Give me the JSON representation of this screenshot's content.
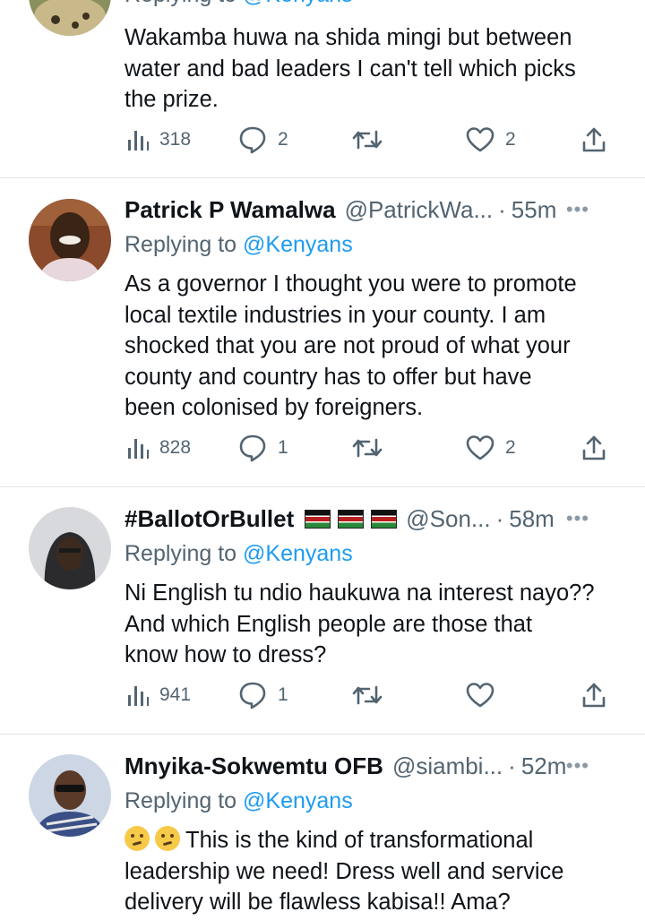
{
  "top_reply": {
    "replying_prefix": "Replying to",
    "replying_handle": "@Kenyans",
    "text_lines": [
      "Wakamba huwa na shida mingi but between",
      "water and bad leaders I can't tell which picks",
      "the prize."
    ],
    "views": "318",
    "replies": "2",
    "retweets": "",
    "likes": "2"
  },
  "tweets": [
    {
      "name": "Patrick P Wamalwa",
      "handle": "@PatrickWa...",
      "dot": "·",
      "time": "55m",
      "more": "•••",
      "replying_prefix": "Replying to",
      "replying_handle": "@Kenyans",
      "text_lines": [
        "As a governor I thought you were to promote",
        "local textile industries in your county. I am",
        "shocked that you are not proud of what your",
        "county and country has to offer but have",
        "been colonised by foreigners."
      ],
      "views": "828",
      "replies": "1",
      "retweets": "",
      "likes": "2"
    },
    {
      "name": "#BallotOrBullet",
      "handle": "@Son...",
      "dot": "·",
      "time": "58m",
      "more": "•••",
      "replying_prefix": "Replying to",
      "replying_handle": "@Kenyans",
      "text_lines": [
        "Ni English tu ndio haukuwa na interest nayo??",
        "And which English people are those that",
        "know how to dress?"
      ],
      "views": "941",
      "replies": "1",
      "retweets": "",
      "likes": ""
    },
    {
      "name": "Mnyika-Sokwemtu OFB",
      "handle": "@siambi...",
      "dot": "·",
      "time": "52m",
      "more": "•••",
      "replying_prefix": "Replying to",
      "replying_handle": "@Kenyans",
      "text_lines": [
        "This is the kind of transformational",
        "leadership we need! Dress well and service",
        "delivery will be flawless kabisa!! Ama?"
      ]
    }
  ],
  "icons": {
    "views": "analytics-icon",
    "reply": "reply-bubble-icon",
    "retweet": "retweet-icon",
    "like": "heart-icon",
    "share": "share-icon",
    "flag": "kenya-flag-emoji",
    "emoji": "thinking-face-emoji"
  },
  "colors": {
    "text": "#0f1419",
    "secondary": "#536471",
    "link": "#1d9bf0",
    "divider": "#e1e6ea"
  }
}
